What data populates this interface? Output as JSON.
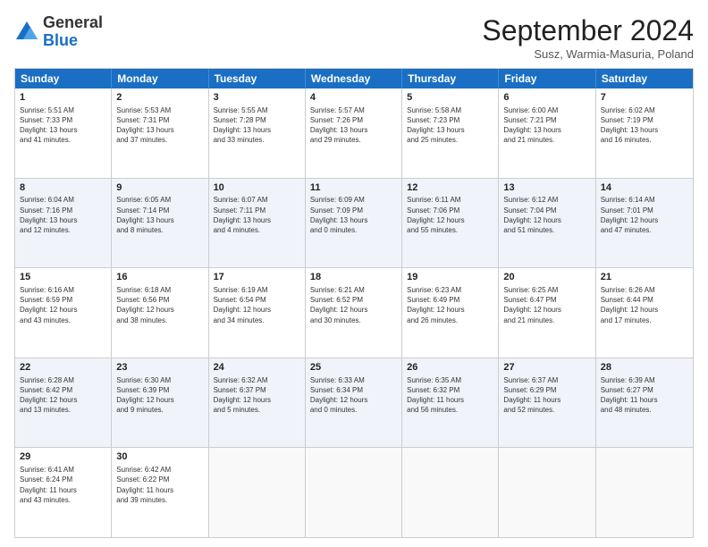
{
  "header": {
    "logo_general": "General",
    "logo_blue": "Blue",
    "month": "September 2024",
    "location": "Susz, Warmia-Masuria, Poland"
  },
  "days_of_week": [
    "Sunday",
    "Monday",
    "Tuesday",
    "Wednesday",
    "Thursday",
    "Friday",
    "Saturday"
  ],
  "weeks": [
    [
      {
        "day": "1",
        "lines": [
          "Sunrise: 5:51 AM",
          "Sunset: 7:33 PM",
          "Daylight: 13 hours",
          "and 41 minutes."
        ]
      },
      {
        "day": "2",
        "lines": [
          "Sunrise: 5:53 AM",
          "Sunset: 7:31 PM",
          "Daylight: 13 hours",
          "and 37 minutes."
        ]
      },
      {
        "day": "3",
        "lines": [
          "Sunrise: 5:55 AM",
          "Sunset: 7:28 PM",
          "Daylight: 13 hours",
          "and 33 minutes."
        ]
      },
      {
        "day": "4",
        "lines": [
          "Sunrise: 5:57 AM",
          "Sunset: 7:26 PM",
          "Daylight: 13 hours",
          "and 29 minutes."
        ]
      },
      {
        "day": "5",
        "lines": [
          "Sunrise: 5:58 AM",
          "Sunset: 7:23 PM",
          "Daylight: 13 hours",
          "and 25 minutes."
        ]
      },
      {
        "day": "6",
        "lines": [
          "Sunrise: 6:00 AM",
          "Sunset: 7:21 PM",
          "Daylight: 13 hours",
          "and 21 minutes."
        ]
      },
      {
        "day": "7",
        "lines": [
          "Sunrise: 6:02 AM",
          "Sunset: 7:19 PM",
          "Daylight: 13 hours",
          "and 16 minutes."
        ]
      }
    ],
    [
      {
        "day": "8",
        "lines": [
          "Sunrise: 6:04 AM",
          "Sunset: 7:16 PM",
          "Daylight: 13 hours",
          "and 12 minutes."
        ]
      },
      {
        "day": "9",
        "lines": [
          "Sunrise: 6:05 AM",
          "Sunset: 7:14 PM",
          "Daylight: 13 hours",
          "and 8 minutes."
        ]
      },
      {
        "day": "10",
        "lines": [
          "Sunrise: 6:07 AM",
          "Sunset: 7:11 PM",
          "Daylight: 13 hours",
          "and 4 minutes."
        ]
      },
      {
        "day": "11",
        "lines": [
          "Sunrise: 6:09 AM",
          "Sunset: 7:09 PM",
          "Daylight: 13 hours",
          "and 0 minutes."
        ]
      },
      {
        "day": "12",
        "lines": [
          "Sunrise: 6:11 AM",
          "Sunset: 7:06 PM",
          "Daylight: 12 hours",
          "and 55 minutes."
        ]
      },
      {
        "day": "13",
        "lines": [
          "Sunrise: 6:12 AM",
          "Sunset: 7:04 PM",
          "Daylight: 12 hours",
          "and 51 minutes."
        ]
      },
      {
        "day": "14",
        "lines": [
          "Sunrise: 6:14 AM",
          "Sunset: 7:01 PM",
          "Daylight: 12 hours",
          "and 47 minutes."
        ]
      }
    ],
    [
      {
        "day": "15",
        "lines": [
          "Sunrise: 6:16 AM",
          "Sunset: 6:59 PM",
          "Daylight: 12 hours",
          "and 43 minutes."
        ]
      },
      {
        "day": "16",
        "lines": [
          "Sunrise: 6:18 AM",
          "Sunset: 6:56 PM",
          "Daylight: 12 hours",
          "and 38 minutes."
        ]
      },
      {
        "day": "17",
        "lines": [
          "Sunrise: 6:19 AM",
          "Sunset: 6:54 PM",
          "Daylight: 12 hours",
          "and 34 minutes."
        ]
      },
      {
        "day": "18",
        "lines": [
          "Sunrise: 6:21 AM",
          "Sunset: 6:52 PM",
          "Daylight: 12 hours",
          "and 30 minutes."
        ]
      },
      {
        "day": "19",
        "lines": [
          "Sunrise: 6:23 AM",
          "Sunset: 6:49 PM",
          "Daylight: 12 hours",
          "and 26 minutes."
        ]
      },
      {
        "day": "20",
        "lines": [
          "Sunrise: 6:25 AM",
          "Sunset: 6:47 PM",
          "Daylight: 12 hours",
          "and 21 minutes."
        ]
      },
      {
        "day": "21",
        "lines": [
          "Sunrise: 6:26 AM",
          "Sunset: 6:44 PM",
          "Daylight: 12 hours",
          "and 17 minutes."
        ]
      }
    ],
    [
      {
        "day": "22",
        "lines": [
          "Sunrise: 6:28 AM",
          "Sunset: 6:42 PM",
          "Daylight: 12 hours",
          "and 13 minutes."
        ]
      },
      {
        "day": "23",
        "lines": [
          "Sunrise: 6:30 AM",
          "Sunset: 6:39 PM",
          "Daylight: 12 hours",
          "and 9 minutes."
        ]
      },
      {
        "day": "24",
        "lines": [
          "Sunrise: 6:32 AM",
          "Sunset: 6:37 PM",
          "Daylight: 12 hours",
          "and 5 minutes."
        ]
      },
      {
        "day": "25",
        "lines": [
          "Sunrise: 6:33 AM",
          "Sunset: 6:34 PM",
          "Daylight: 12 hours",
          "and 0 minutes."
        ]
      },
      {
        "day": "26",
        "lines": [
          "Sunrise: 6:35 AM",
          "Sunset: 6:32 PM",
          "Daylight: 11 hours",
          "and 56 minutes."
        ]
      },
      {
        "day": "27",
        "lines": [
          "Sunrise: 6:37 AM",
          "Sunset: 6:29 PM",
          "Daylight: 11 hours",
          "and 52 minutes."
        ]
      },
      {
        "day": "28",
        "lines": [
          "Sunrise: 6:39 AM",
          "Sunset: 6:27 PM",
          "Daylight: 11 hours",
          "and 48 minutes."
        ]
      }
    ],
    [
      {
        "day": "29",
        "lines": [
          "Sunrise: 6:41 AM",
          "Sunset: 6:24 PM",
          "Daylight: 11 hours",
          "and 43 minutes."
        ]
      },
      {
        "day": "30",
        "lines": [
          "Sunrise: 6:42 AM",
          "Sunset: 6:22 PM",
          "Daylight: 11 hours",
          "and 39 minutes."
        ]
      },
      {
        "day": "",
        "lines": []
      },
      {
        "day": "",
        "lines": []
      },
      {
        "day": "",
        "lines": []
      },
      {
        "day": "",
        "lines": []
      },
      {
        "day": "",
        "lines": []
      }
    ]
  ],
  "row_alts": [
    false,
    true,
    false,
    true,
    false
  ]
}
